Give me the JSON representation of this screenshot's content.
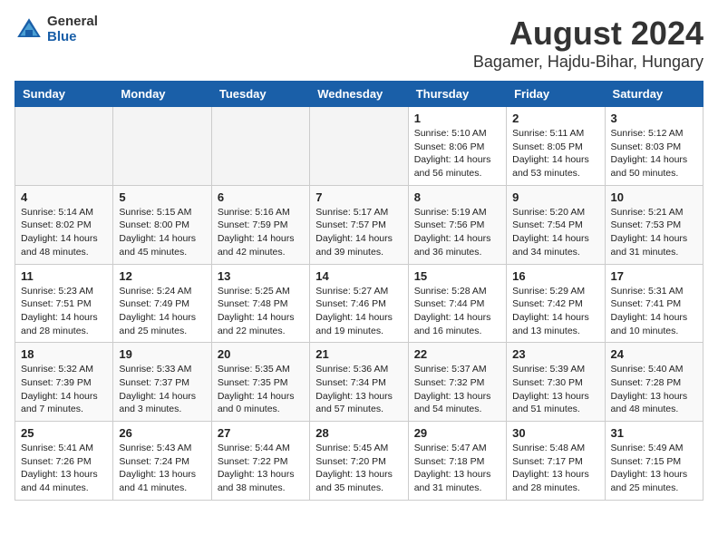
{
  "header": {
    "logo_general": "General",
    "logo_blue": "Blue",
    "title": "August 2024",
    "subtitle": "Bagamer, Hajdu-Bihar, Hungary"
  },
  "weekdays": [
    "Sunday",
    "Monday",
    "Tuesday",
    "Wednesday",
    "Thursday",
    "Friday",
    "Saturday"
  ],
  "weeks": [
    [
      {
        "day": "",
        "info": ""
      },
      {
        "day": "",
        "info": ""
      },
      {
        "day": "",
        "info": ""
      },
      {
        "day": "",
        "info": ""
      },
      {
        "day": "1",
        "info": "Sunrise: 5:10 AM\nSunset: 8:06 PM\nDaylight: 14 hours\nand 56 minutes."
      },
      {
        "day": "2",
        "info": "Sunrise: 5:11 AM\nSunset: 8:05 PM\nDaylight: 14 hours\nand 53 minutes."
      },
      {
        "day": "3",
        "info": "Sunrise: 5:12 AM\nSunset: 8:03 PM\nDaylight: 14 hours\nand 50 minutes."
      }
    ],
    [
      {
        "day": "4",
        "info": "Sunrise: 5:14 AM\nSunset: 8:02 PM\nDaylight: 14 hours\nand 48 minutes."
      },
      {
        "day": "5",
        "info": "Sunrise: 5:15 AM\nSunset: 8:00 PM\nDaylight: 14 hours\nand 45 minutes."
      },
      {
        "day": "6",
        "info": "Sunrise: 5:16 AM\nSunset: 7:59 PM\nDaylight: 14 hours\nand 42 minutes."
      },
      {
        "day": "7",
        "info": "Sunrise: 5:17 AM\nSunset: 7:57 PM\nDaylight: 14 hours\nand 39 minutes."
      },
      {
        "day": "8",
        "info": "Sunrise: 5:19 AM\nSunset: 7:56 PM\nDaylight: 14 hours\nand 36 minutes."
      },
      {
        "day": "9",
        "info": "Sunrise: 5:20 AM\nSunset: 7:54 PM\nDaylight: 14 hours\nand 34 minutes."
      },
      {
        "day": "10",
        "info": "Sunrise: 5:21 AM\nSunset: 7:53 PM\nDaylight: 14 hours\nand 31 minutes."
      }
    ],
    [
      {
        "day": "11",
        "info": "Sunrise: 5:23 AM\nSunset: 7:51 PM\nDaylight: 14 hours\nand 28 minutes."
      },
      {
        "day": "12",
        "info": "Sunrise: 5:24 AM\nSunset: 7:49 PM\nDaylight: 14 hours\nand 25 minutes."
      },
      {
        "day": "13",
        "info": "Sunrise: 5:25 AM\nSunset: 7:48 PM\nDaylight: 14 hours\nand 22 minutes."
      },
      {
        "day": "14",
        "info": "Sunrise: 5:27 AM\nSunset: 7:46 PM\nDaylight: 14 hours\nand 19 minutes."
      },
      {
        "day": "15",
        "info": "Sunrise: 5:28 AM\nSunset: 7:44 PM\nDaylight: 14 hours\nand 16 minutes."
      },
      {
        "day": "16",
        "info": "Sunrise: 5:29 AM\nSunset: 7:42 PM\nDaylight: 14 hours\nand 13 minutes."
      },
      {
        "day": "17",
        "info": "Sunrise: 5:31 AM\nSunset: 7:41 PM\nDaylight: 14 hours\nand 10 minutes."
      }
    ],
    [
      {
        "day": "18",
        "info": "Sunrise: 5:32 AM\nSunset: 7:39 PM\nDaylight: 14 hours\nand 7 minutes."
      },
      {
        "day": "19",
        "info": "Sunrise: 5:33 AM\nSunset: 7:37 PM\nDaylight: 14 hours\nand 3 minutes."
      },
      {
        "day": "20",
        "info": "Sunrise: 5:35 AM\nSunset: 7:35 PM\nDaylight: 14 hours\nand 0 minutes."
      },
      {
        "day": "21",
        "info": "Sunrise: 5:36 AM\nSunset: 7:34 PM\nDaylight: 13 hours\nand 57 minutes."
      },
      {
        "day": "22",
        "info": "Sunrise: 5:37 AM\nSunset: 7:32 PM\nDaylight: 13 hours\nand 54 minutes."
      },
      {
        "day": "23",
        "info": "Sunrise: 5:39 AM\nSunset: 7:30 PM\nDaylight: 13 hours\nand 51 minutes."
      },
      {
        "day": "24",
        "info": "Sunrise: 5:40 AM\nSunset: 7:28 PM\nDaylight: 13 hours\nand 48 minutes."
      }
    ],
    [
      {
        "day": "25",
        "info": "Sunrise: 5:41 AM\nSunset: 7:26 PM\nDaylight: 13 hours\nand 44 minutes."
      },
      {
        "day": "26",
        "info": "Sunrise: 5:43 AM\nSunset: 7:24 PM\nDaylight: 13 hours\nand 41 minutes."
      },
      {
        "day": "27",
        "info": "Sunrise: 5:44 AM\nSunset: 7:22 PM\nDaylight: 13 hours\nand 38 minutes."
      },
      {
        "day": "28",
        "info": "Sunrise: 5:45 AM\nSunset: 7:20 PM\nDaylight: 13 hours\nand 35 minutes."
      },
      {
        "day": "29",
        "info": "Sunrise: 5:47 AM\nSunset: 7:18 PM\nDaylight: 13 hours\nand 31 minutes."
      },
      {
        "day": "30",
        "info": "Sunrise: 5:48 AM\nSunset: 7:17 PM\nDaylight: 13 hours\nand 28 minutes."
      },
      {
        "day": "31",
        "info": "Sunrise: 5:49 AM\nSunset: 7:15 PM\nDaylight: 13 hours\nand 25 minutes."
      }
    ]
  ]
}
